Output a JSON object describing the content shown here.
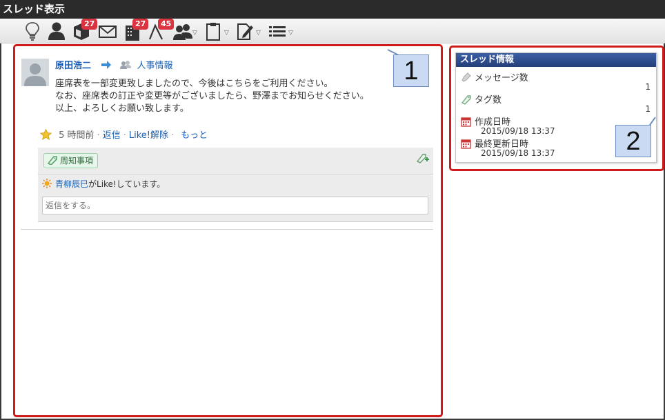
{
  "window": {
    "title": "スレッド表示"
  },
  "toolbar": {
    "badges": {
      "files": "27",
      "org": "27",
      "workflow": "45"
    },
    "icons": [
      "lightbulb-icon",
      "user-icon",
      "cube-icon",
      "mail-icon",
      "building-icon",
      "workflow-icon",
      "group-icon",
      "clipboard-icon",
      "edit-icon",
      "list-icon"
    ]
  },
  "post": {
    "author": "原田浩二",
    "group": "人事情報",
    "body": [
      "座席表を一部変更致しましたので、今後はこちらをご利用ください。",
      "なお、座席表の訂正や変更等がございましたら、野澤までお知らせください。",
      "以上、よろしくお願い致します。"
    ],
    "time_ago": "5 時間前",
    "actions": {
      "reply": "返信",
      "unlike": "Like!解除",
      "more": "もっと"
    },
    "tag": "周知事項",
    "liked_by": "青柳辰巳",
    "liked_suffix": "がLike!しています。",
    "reply_placeholder": "返信をする。"
  },
  "thread_info": {
    "header": "スレッド情報",
    "message_count_label": "メッセージ数",
    "message_count": "1",
    "tag_count_label": "タグ数",
    "tag_count": "1",
    "created_label": "作成日時",
    "created": "2015/09/18 13:37",
    "updated_label": "最終更新日時",
    "updated": "2015/09/18 13:37"
  },
  "callouts": {
    "first": "1",
    "second": "2"
  },
  "colors": {
    "highlight": "#d11a1a",
    "link": "#1a5fb4",
    "badge": "#d9343f",
    "panel_header": "#2f4f8f"
  }
}
